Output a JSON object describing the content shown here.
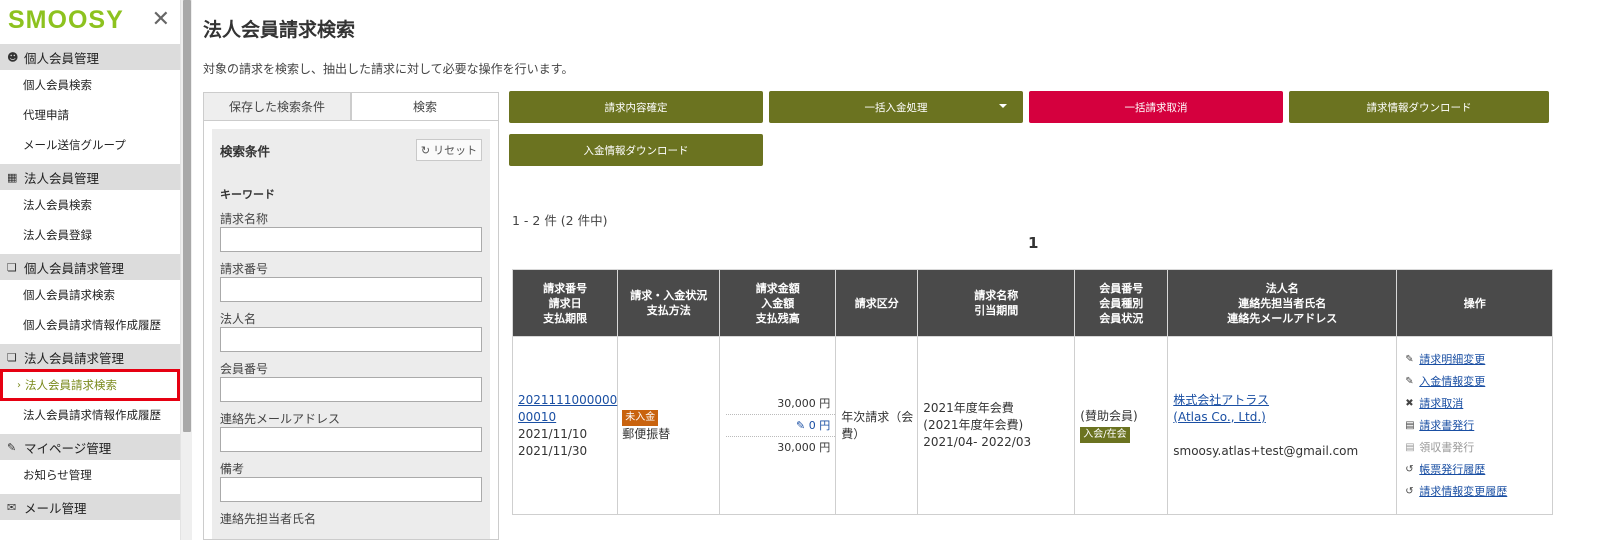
{
  "sidebar": {
    "logo_text": "SMOOSY",
    "groups": [
      {
        "label": "個人会員管理",
        "icon": "user-icon",
        "items": [
          {
            "label": "個人会員検索"
          },
          {
            "label": "代理申請"
          },
          {
            "label": "メール送信グループ"
          }
        ]
      },
      {
        "label": "法人会員管理",
        "icon": "building-icon",
        "items": [
          {
            "label": "法人会員検索"
          },
          {
            "label": "法人会員登録"
          }
        ]
      },
      {
        "label": "個人会員請求管理",
        "icon": "copy-icon",
        "items": [
          {
            "label": "個人会員請求検索"
          },
          {
            "label": "個人会員請求情報作成履歴"
          }
        ]
      },
      {
        "label": "法人会員請求管理",
        "icon": "copy-icon",
        "items": [
          {
            "label": "法人会員請求検索"
          },
          {
            "label": "法人会員請求情報作成履歴"
          }
        ]
      },
      {
        "label": "マイページ管理",
        "icon": "pen-icon",
        "items": [
          {
            "label": "お知らせ管理"
          }
        ]
      },
      {
        "label": "メール管理",
        "icon": "mail-icon",
        "items": []
      }
    ]
  },
  "page": {
    "title": "法人会員請求検索",
    "description": "対象の請求を検索し、抽出した請求に対して必要な操作を行います。"
  },
  "search": {
    "tabs": [
      "保存した検索条件",
      "検索"
    ],
    "active_tab": 1,
    "section_title": "検索条件",
    "reset_label": "リセット",
    "keyword_label": "キーワード",
    "fields": [
      {
        "label": "請求名称",
        "value": ""
      },
      {
        "label": "請求番号",
        "value": ""
      },
      {
        "label": "法人名",
        "value": ""
      },
      {
        "label": "会員番号",
        "value": ""
      },
      {
        "label": "連絡先メールアドレス",
        "value": ""
      },
      {
        "label": "備考",
        "value": ""
      },
      {
        "label": "連絡先担当者氏名",
        "value": ""
      }
    ]
  },
  "actions": {
    "confirm": "請求内容確定",
    "bulk_payment": "一括入金処理",
    "bulk_cancel": "一括請求取消",
    "download_billing": "請求情報ダウンロード",
    "download_payment": "入金情報ダウンロード"
  },
  "results": {
    "count_text": "1 - 2 件 (2 件中)",
    "page": "1",
    "headers": [
      "請求番号\n請求日\n支払期限",
      "請求・入金状況\n支払方法",
      "請求金額\n入金額\n支払残高",
      "請求区分",
      "請求名称\n引当期間",
      "会員番号\n会員種別\n会員状況",
      "法人名\n連絡先担当者氏名\n連絡先メールアドレス",
      "操作"
    ],
    "rows": [
      {
        "bill_no_1": "2021111000000",
        "bill_no_2": "00010",
        "bill_date": "2021/11/10",
        "due_date": "2021/11/30",
        "status_badge": "未入金",
        "pay_method": "郵便振替",
        "bill_amount": "30,000 円",
        "paid_amount": "0 円",
        "balance": "30,000 円",
        "category": "年次請求（会費）",
        "name_1": "2021年度年会費",
        "name_2": "(2021年度年会費)",
        "period": "2021/04- 2022/03",
        "member_type": "(賛助会員)",
        "member_status": "入会/在会",
        "corp_name_1": "株式会社アトラス",
        "corp_name_2": "(Atlas Co., Ltd.)",
        "email": "smoosy.atlas+test@gmail.com",
        "ops": [
          {
            "label": "請求明細変更",
            "icon": "pencil-icon",
            "enabled": true
          },
          {
            "label": "入金情報変更",
            "icon": "pencil-icon",
            "enabled": true
          },
          {
            "label": "請求取消",
            "icon": "x-icon",
            "enabled": true
          },
          {
            "label": "請求書発行",
            "icon": "document-icon",
            "enabled": true
          },
          {
            "label": "領収書発行",
            "icon": "document-icon",
            "enabled": false
          },
          {
            "label": "帳票発行履歴",
            "icon": "history-icon",
            "enabled": true
          },
          {
            "label": "請求情報変更履歴",
            "icon": "history-icon",
            "enabled": true
          }
        ]
      }
    ]
  },
  "colors": {
    "olive": "#6b7320",
    "red": "#d5003e",
    "brand_green": "#8dc21f",
    "header_dark": "#4a4a4a",
    "link": "#1a4fa3"
  }
}
